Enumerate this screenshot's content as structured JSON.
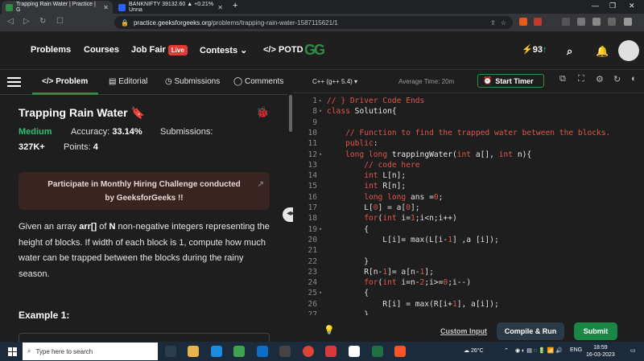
{
  "browser": {
    "tabs": [
      {
        "title": "Trapping Rain Water | Practice | G",
        "active": true,
        "favicon_color": "#2f8d46"
      },
      {
        "title": "BANKNIFTY 39132.60 ▲ +0.21% Unna",
        "active": false,
        "favicon_color": "#2962ff"
      }
    ],
    "new_tab": "+",
    "url_host": "practice.geeksforgeeks.org",
    "url_path": "/problems/trapping-rain-water-1587115621/1"
  },
  "site_nav": {
    "links": [
      "Problems",
      "Courses",
      "Job Fair",
      "Contests"
    ],
    "live_badge": "Live",
    "potd": "POTD",
    "logo": "GG",
    "streak": "93",
    "colors": {
      "brand": "#2f8d46",
      "live": "#e53935"
    }
  },
  "left_tabs": {
    "problem": "Problem",
    "editorial": "Editorial",
    "submissions": "Submissions",
    "comments": "Comments"
  },
  "problem": {
    "title": "Trapping Rain Water",
    "difficulty": "Medium",
    "accuracy_label": "Accuracy:",
    "accuracy_value": "33.14%",
    "submissions_label": "Submissions:",
    "submissions_value": "327K+",
    "points_label": "Points:",
    "points_value": "4",
    "banner": "Participate in Monthly Hiring Challenge conducted by GeeksforGeeks !!",
    "desc_1": "Given an array ",
    "desc_arr": "arr[]",
    "desc_2": " of ",
    "desc_n": "N",
    "desc_3": " non-negative integers representing the height of blocks. If width of each block is 1, compute how much water can be trapped between the blocks during the rainy season.",
    "example_heading": "Example 1:"
  },
  "editor": {
    "language": "C++ (g++ 5.4)",
    "avg_time": "Average Time: 20m",
    "start_timer": "Start Timer",
    "lines": [
      {
        "n": "1",
        "fold": "▸",
        "text": "// } Driver Code Ends"
      },
      {
        "n": "8",
        "fold": "▾",
        "text": "class Solution{"
      },
      {
        "n": "9",
        "fold": "",
        "text": ""
      },
      {
        "n": "10",
        "fold": "",
        "text": "    // Function to find the trapped water between the blocks."
      },
      {
        "n": "11",
        "fold": "",
        "text": "    public:"
      },
      {
        "n": "12",
        "fold": "▾",
        "text": "    long long trappingWater(int a[], int n){"
      },
      {
        "n": "13",
        "fold": "",
        "text": "        // code here"
      },
      {
        "n": "14",
        "fold": "",
        "text": "        int L[n];"
      },
      {
        "n": "15",
        "fold": "",
        "text": "        int R[n];"
      },
      {
        "n": "16",
        "fold": "",
        "text": "        long long ans =0;"
      },
      {
        "n": "17",
        "fold": "",
        "text": "        L[0] = a[0];"
      },
      {
        "n": "18",
        "fold": "",
        "text": "        for(int i=1;i<n;i++)"
      },
      {
        "n": "19",
        "fold": "▾",
        "text": "        {"
      },
      {
        "n": "20",
        "fold": "",
        "text": "            L[i]= max(L[i-1] ,a [i]);"
      },
      {
        "n": "21",
        "fold": "",
        "text": ""
      },
      {
        "n": "22",
        "fold": "",
        "text": "        }"
      },
      {
        "n": "23",
        "fold": "",
        "text": "        R[n-1]= a[n-1];"
      },
      {
        "n": "24",
        "fold": "",
        "text": "        for(int i=n-2;i>=0;i--)"
      },
      {
        "n": "25",
        "fold": "▾",
        "text": "        {"
      },
      {
        "n": "26",
        "fold": "",
        "text": "            R[i] = max(R[i+1], a[i]);"
      },
      {
        "n": "27",
        "fold": "",
        "text": "        }"
      }
    ],
    "custom_input": "Custom Input",
    "compile_run": "Compile & Run",
    "submit": "Submit"
  },
  "taskbar": {
    "search_placeholder": "Type here to search",
    "weather": "26°C",
    "lang": "ENG",
    "time": "18:59",
    "date": "16-03-2023"
  }
}
